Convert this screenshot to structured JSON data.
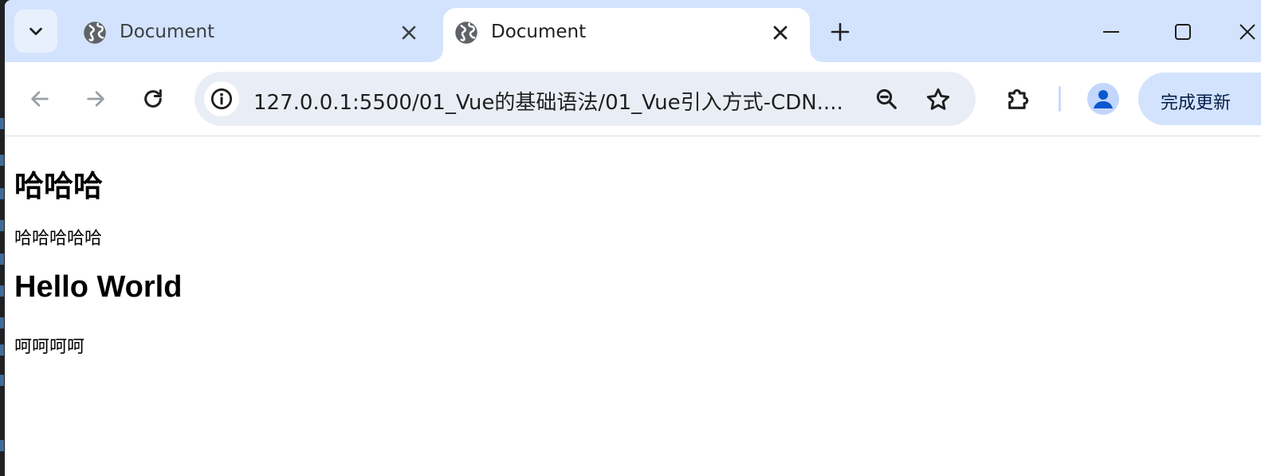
{
  "browser": {
    "colors": {
      "titlebar": "#d3e3fd",
      "omnibox": "#e9eef6",
      "accent": "#0b57d0"
    },
    "tabs": [
      {
        "title": "Document",
        "active": false,
        "icon": "globe-icon"
      },
      {
        "title": "Document",
        "active": true,
        "icon": "globe-icon"
      }
    ],
    "address_bar": {
      "url": "127.0.0.1:5500/01_Vue的基础语法/01_Vue引入方式-CDN...."
    },
    "update_button": {
      "label": "完成更新"
    }
  },
  "page": {
    "heading1": "哈哈哈",
    "paragraph1": "哈哈哈哈哈",
    "heading2": "Hello World",
    "paragraph2": "呵呵呵呵"
  }
}
